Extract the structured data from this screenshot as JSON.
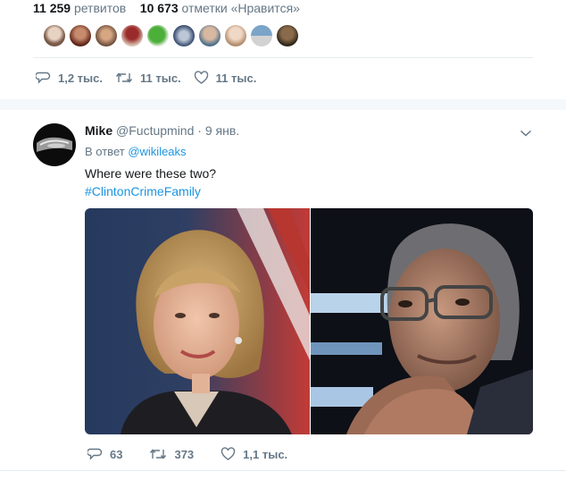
{
  "stats": {
    "retweets_count": "11 259",
    "retweets_label": "ретвитов",
    "likes_count": "10 673",
    "likes_label": "отметки «Нравится»"
  },
  "top_actions": {
    "replies": "1,2 тыс.",
    "retweets": "11 тыс.",
    "likes": "11 тыс."
  },
  "tweet": {
    "name": "Mike",
    "handle": "@Fuctupmind",
    "dot": "·",
    "date": "9 янв.",
    "reply_prefix": "В ответ",
    "reply_to": "@wikileaks",
    "text": "Where were these two?",
    "hashtag": "#ClintonCrimeFamily",
    "replies": "63",
    "retweets": "373",
    "likes": "1,1 тыс."
  },
  "icons": {
    "reply": "reply-icon",
    "retweet": "retweet-icon",
    "like": "heart-icon",
    "caret": "chevron-down-icon"
  },
  "colors": {
    "link": "#1b95e0",
    "muted": "#657786"
  }
}
